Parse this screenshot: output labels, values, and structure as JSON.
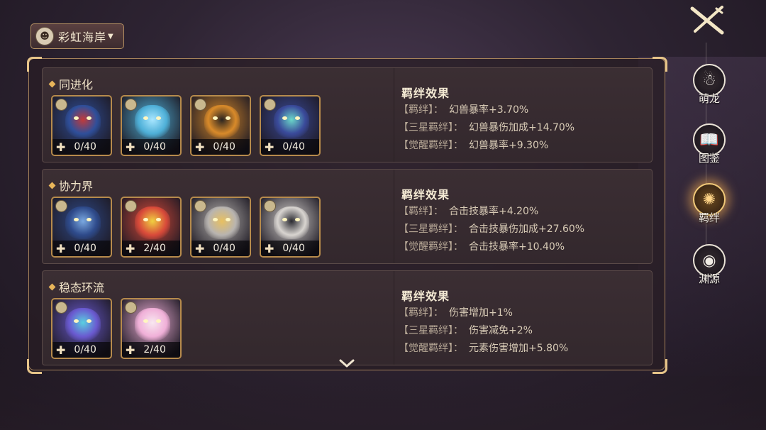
{
  "world_selector": {
    "label": "彩虹海岸"
  },
  "side_nav": [
    {
      "label": "萌龙",
      "icon": "dragon-face-icon",
      "active": false
    },
    {
      "label": "图鉴",
      "icon": "book-icon",
      "active": false
    },
    {
      "label": "羁绊",
      "icon": "bond-gear-icon",
      "active": true
    },
    {
      "label": "渊源",
      "icon": "origin-eye-icon",
      "active": false
    }
  ],
  "groups": [
    {
      "title": "同进化",
      "pets": [
        {
          "count": "0/40",
          "color": "#2f4f9a",
          "accent": "#c23a3a"
        },
        {
          "count": "0/40",
          "color": "#4fb0d8",
          "accent": "#a9e6ff"
        },
        {
          "count": "0/40",
          "color": "#d88a2a",
          "accent": "#2a2420"
        },
        {
          "count": "0/40",
          "color": "#3a4a9a",
          "accent": "#6ad6c8"
        }
      ],
      "effects_title": "羁绊效果",
      "effects": [
        {
          "label": "【羁绊】：",
          "value": "幻兽暴率+3.70%"
        },
        {
          "label": "【三星羁绊】：",
          "value": "幻兽暴伤加成+14.70%"
        },
        {
          "label": "【觉醒羁绊】：",
          "value": "幻兽暴率+9.30%"
        }
      ]
    },
    {
      "title": "协力界",
      "pets": [
        {
          "count": "0/40",
          "color": "#2e4a8a",
          "accent": "#7aa8e0"
        },
        {
          "count": "2/40",
          "color": "#d84a3a",
          "accent": "#f0d040"
        },
        {
          "count": "0/40",
          "color": "#b8b4b0",
          "accent": "#e8c060"
        },
        {
          "count": "0/40",
          "color": "#d8d4d0",
          "accent": "#2a2a30"
        }
      ],
      "effects_title": "羁绊效果",
      "effects": [
        {
          "label": "【羁绊】：",
          "value": "合击技暴率+4.20%"
        },
        {
          "label": "【三星羁绊】：",
          "value": "合击技暴伤加成+27.60%"
        },
        {
          "label": "【觉醒羁绊】：",
          "value": "合击技暴率+10.40%"
        }
      ]
    },
    {
      "title": "稳态环流",
      "pets": [
        {
          "count": "0/40",
          "color": "#6a5ad0",
          "accent": "#5ad0e0"
        },
        {
          "count": "2/40",
          "color": "#f0b0d8",
          "accent": "#f8e8f0"
        }
      ],
      "effects_title": "羁绊效果",
      "effects": [
        {
          "label": "【羁绊】：",
          "value": "伤害增加+1%"
        },
        {
          "label": "【三星羁绊】：",
          "value": "伤害减免+2%"
        },
        {
          "label": "【觉醒羁绊】：",
          "value": "元素伤害增加+5.80%"
        }
      ]
    }
  ]
}
